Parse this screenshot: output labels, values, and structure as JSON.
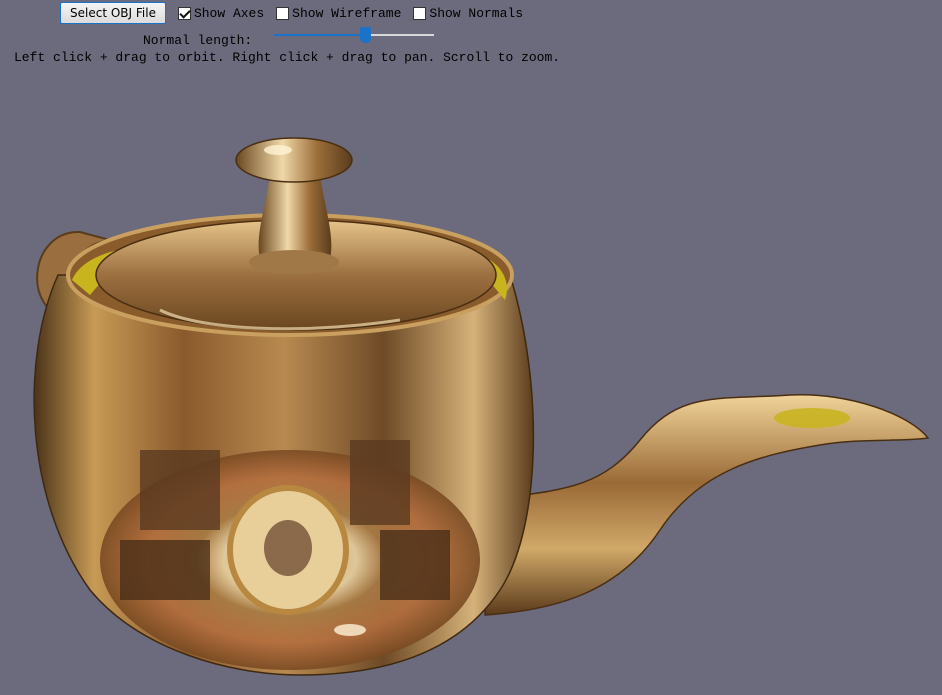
{
  "toolbar": {
    "select_file_label": "Select OBJ File",
    "show_axes_label": "Show Axes",
    "show_axes_checked": true,
    "show_wireframe_label": "Show Wireframe",
    "show_wireframe_checked": false,
    "show_normals_label": "Show Normals",
    "show_normals_checked": false
  },
  "normal_length": {
    "label": "Normal length:",
    "value_fraction": 0.57
  },
  "instructions": "Left click + drag to orbit. Right click + drag to pan. Scroll to zoom.",
  "colors": {
    "background": "#6b6b7d",
    "accent": "#1a72c9"
  }
}
